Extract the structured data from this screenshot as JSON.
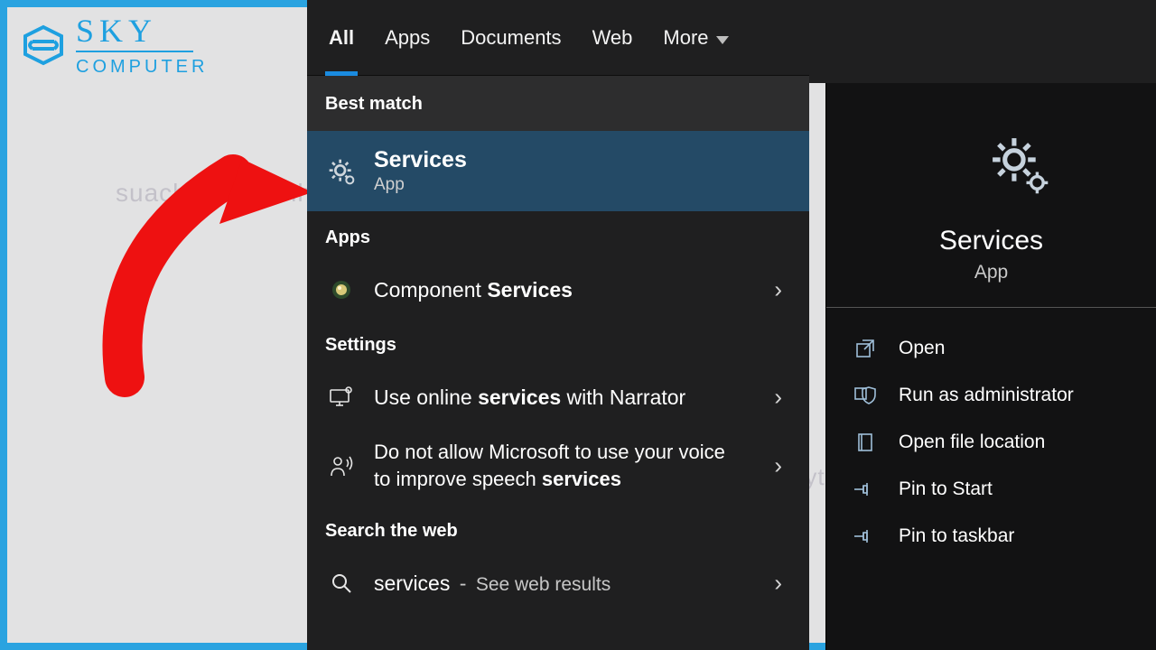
{
  "logo": {
    "line1": "SKY",
    "line2": "COMPUTER"
  },
  "watermark": "suachuamaytinhdanang.com",
  "tabs": {
    "all": "All",
    "apps": "Apps",
    "documents": "Documents",
    "web": "Web",
    "more": "More"
  },
  "sections": {
    "best_match": "Best match",
    "apps": "Apps",
    "settings": "Settings",
    "search_web": "Search the web"
  },
  "best": {
    "title": "Services",
    "type": "App"
  },
  "apps_list": [
    {
      "prefix": "Component ",
      "bold": "Services"
    }
  ],
  "settings_list": [
    {
      "t1": "Use online ",
      "b": "services",
      "t2": " with Narrator"
    },
    {
      "t1": "Do not allow Microsoft to use your voice to improve speech ",
      "b": "services",
      "t2": ""
    }
  ],
  "web": {
    "query": "services",
    "see": "See web results"
  },
  "detail": {
    "title": "Services",
    "type": "App",
    "actions": {
      "open": "Open",
      "admin": "Run as administrator",
      "location": "Open file location",
      "pin_start": "Pin to Start",
      "pin_taskbar": "Pin to taskbar"
    }
  }
}
